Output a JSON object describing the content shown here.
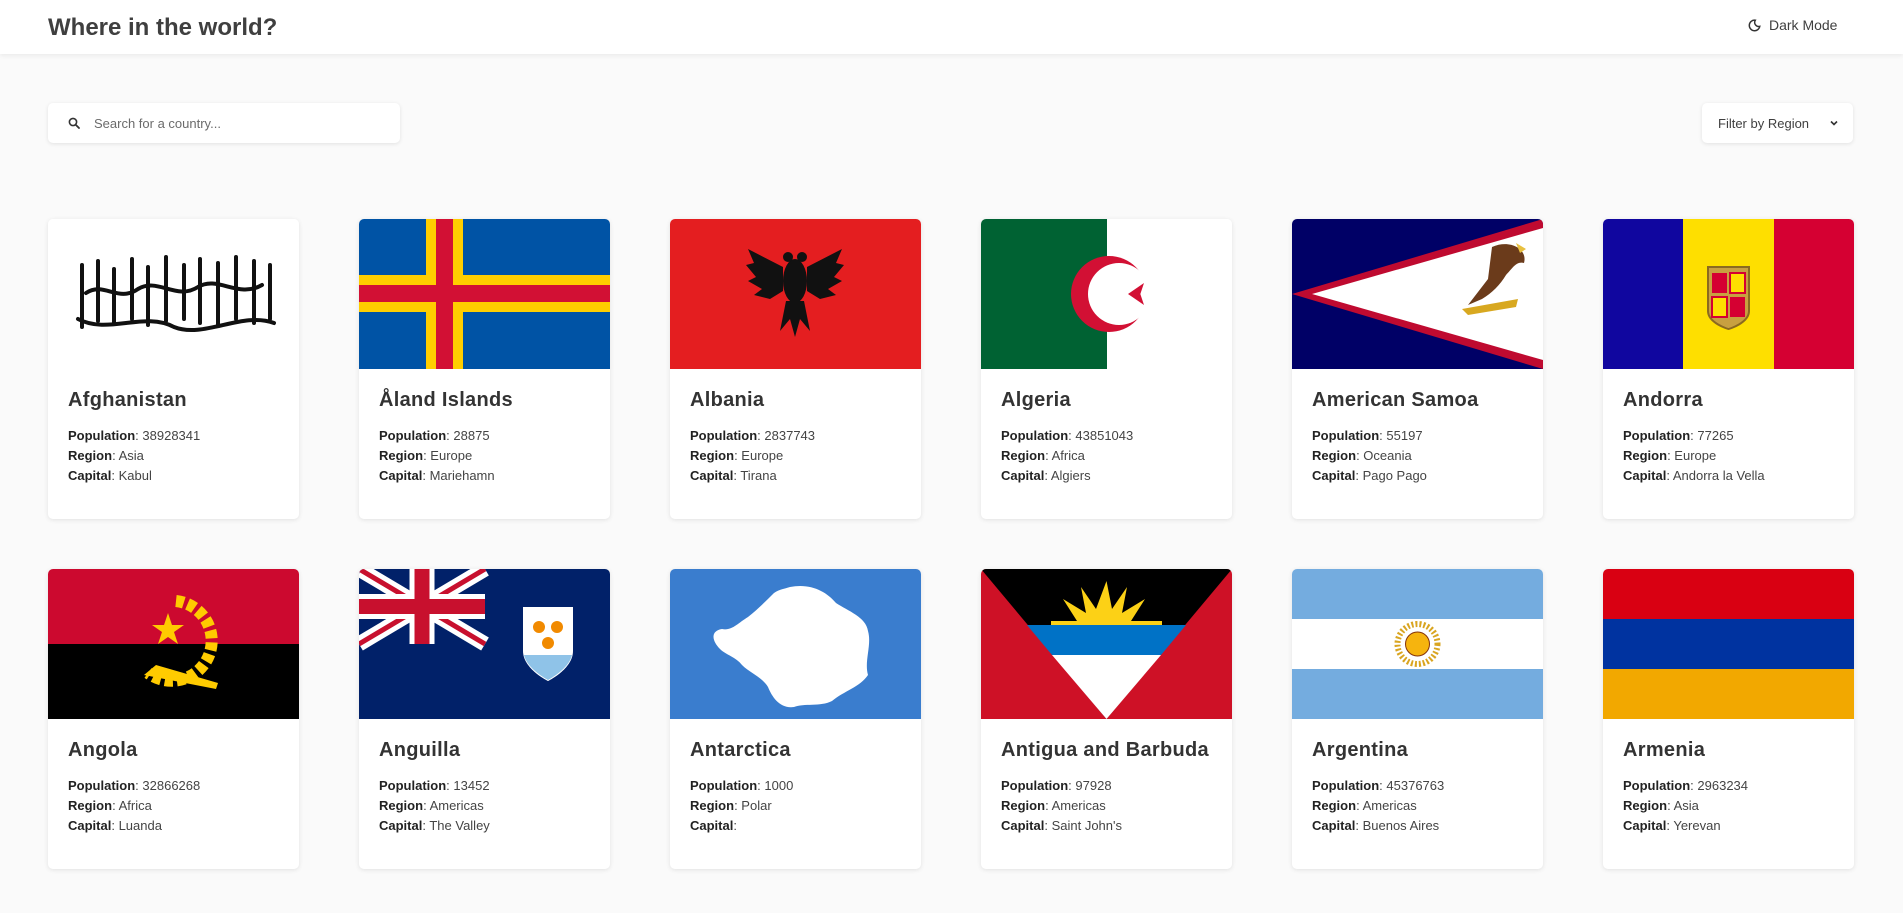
{
  "header": {
    "title": "Where in the world?",
    "dark_mode_label": "Dark Mode"
  },
  "search": {
    "placeholder": "Search for a country..."
  },
  "filter": {
    "label": "Filter by Region"
  },
  "field_labels": {
    "population": "Population",
    "region": "Region",
    "capital": "Capital"
  },
  "countries": [
    {
      "name": "Afghanistan",
      "population": "38928341",
      "region": "Asia",
      "capital": "Kabul"
    },
    {
      "name": "Åland Islands",
      "population": "28875",
      "region": "Europe",
      "capital": "Mariehamn"
    },
    {
      "name": "Albania",
      "population": "2837743",
      "region": "Europe",
      "capital": "Tirana"
    },
    {
      "name": "Algeria",
      "population": "43851043",
      "region": "Africa",
      "capital": "Algiers"
    },
    {
      "name": "American Samoa",
      "population": "55197",
      "region": "Oceania",
      "capital": "Pago Pago"
    },
    {
      "name": "Andorra",
      "population": "77265",
      "region": "Europe",
      "capital": "Andorra la Vella"
    },
    {
      "name": "Angola",
      "population": "32866268",
      "region": "Africa",
      "capital": "Luanda"
    },
    {
      "name": "Anguilla",
      "population": "13452",
      "region": "Americas",
      "capital": "The Valley"
    },
    {
      "name": "Antarctica",
      "population": "1000",
      "region": "Polar",
      "capital": ""
    },
    {
      "name": "Antigua and Barbuda",
      "population": "97928",
      "region": "Americas",
      "capital": "Saint John's"
    },
    {
      "name": "Argentina",
      "population": "45376763",
      "region": "Americas",
      "capital": "Buenos Aires"
    },
    {
      "name": "Armenia",
      "population": "2963234",
      "region": "Asia",
      "capital": "Yerevan"
    }
  ]
}
